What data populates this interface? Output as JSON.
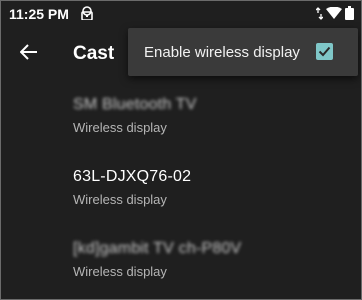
{
  "status_bar": {
    "time": "11:25 PM",
    "icons": [
      "lock-icon",
      "data-arrows-icon",
      "wifi-icon",
      "battery-icon"
    ]
  },
  "app_bar": {
    "back_icon": "arrow-back-icon",
    "title": "Cast"
  },
  "overflow_menu": {
    "item_label": "Enable wireless display",
    "checked": true,
    "accent_color": "#7fc7c8"
  },
  "devices": [
    {
      "name": "SM Bluetooth TV",
      "subtitle": "Wireless display",
      "name_blurred": true
    },
    {
      "name": "63L-DJXQ76-02",
      "subtitle": "Wireless display",
      "name_blurred": false
    },
    {
      "name": "[kd]gambit TV ch-P80V",
      "subtitle": "Wireless display",
      "name_blurred": true
    }
  ],
  "colors": {
    "background": "#1f1f1f",
    "menu_background": "#3a3a3a",
    "secondary_text": "#b5b5b5"
  }
}
